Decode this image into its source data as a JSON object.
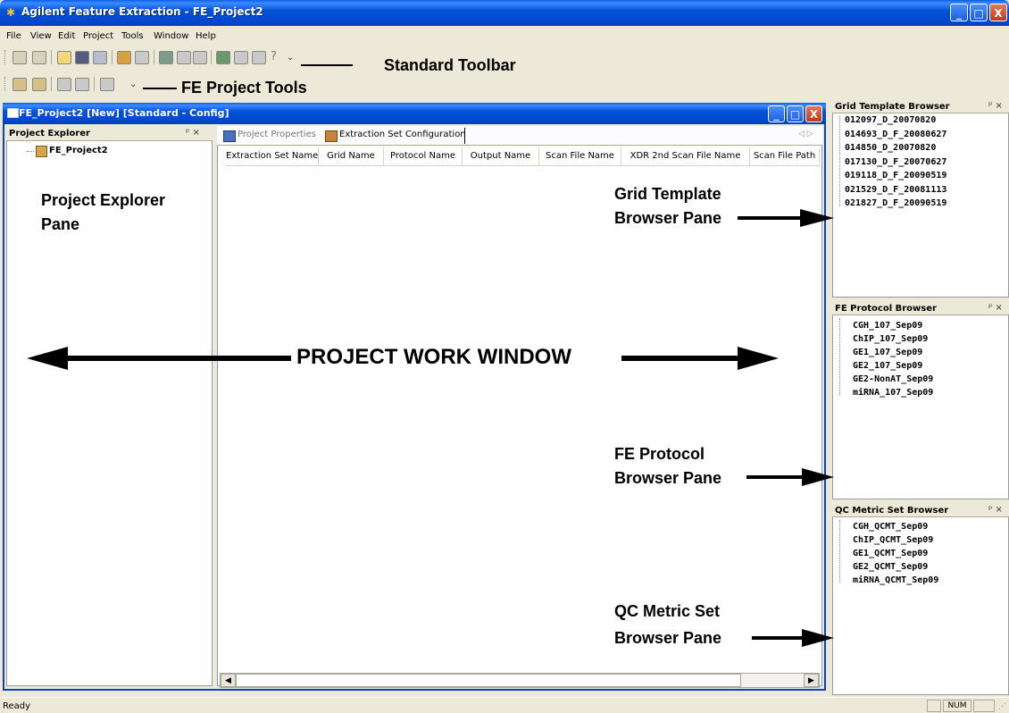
{
  "window": {
    "title": "Agilent Feature Extraction - FE_Project2",
    "minimize": "_",
    "maximize": "□",
    "close": "X"
  },
  "menu": {
    "items": [
      {
        "label": "File"
      },
      {
        "label": "View"
      },
      {
        "label": "Edit"
      },
      {
        "label": "Project"
      },
      {
        "label": "Tools"
      },
      {
        "label": "Window"
      },
      {
        "label": "Help"
      }
    ]
  },
  "callouts": {
    "standard_toolbar": "Standard Toolbar",
    "fe_project_tools": "FE Project Tools",
    "project_explorer_pane_line1": "Project Explorer",
    "project_explorer_pane_line2": "Pane",
    "project_work_window": "PROJECT WORK WINDOW",
    "grid_template_line1": "Grid Template",
    "grid_template_line2": "Browser Pane",
    "fe_protocol_line1": "FE Protocol",
    "fe_protocol_line2": "Browser Pane",
    "qc_metric_line1": "QC Metric Set",
    "qc_metric_line2": "Browser Pane"
  },
  "work_window": {
    "title": "FE_Project2 [New] [Standard - Config]"
  },
  "project_explorer": {
    "header": "Project Explorer",
    "pin": "ᵖ ×",
    "root": "FE_Project2"
  },
  "doc_tabs": [
    {
      "label": "Project Properties"
    },
    {
      "label": "Extraction Set Configuration"
    }
  ],
  "tab_nav": "◁ ▷",
  "columns": [
    "Extraction Set Name",
    "Grid Name",
    "Protocol Name",
    "Output Name",
    "Scan File Name",
    "XDR 2nd Scan File Name",
    "Scan File Path"
  ],
  "grid_template_browser": {
    "header": "Grid Template Browser",
    "pin": "ᵖ ×",
    "items": [
      "012097_D_20070820",
      "014693_D_F_20080627",
      "014850_D_20070820",
      "017130_D_F_20070627",
      "019118_D_F_20090519",
      "021529_D_F_20081113",
      "021827_D_F_20090519"
    ]
  },
  "fe_protocol_browser": {
    "header": "FE Protocol Browser",
    "pin": "ᵖ ×",
    "items": [
      "CGH_107_Sep09",
      "ChIP_107_Sep09",
      "GE1_107_Sep09",
      "GE2_107_Sep09",
      "GE2-NonAT_Sep09",
      "miRNA_107_Sep09"
    ]
  },
  "qc_metric_browser": {
    "header": "QC Metric Set Browser",
    "pin": "ᵖ ×",
    "items": [
      "CGH_QCMT_Sep09",
      "ChIP_QCMT_Sep09",
      "GE1_QCMT_Sep09",
      "GE2_QCMT_Sep09",
      "miRNA_QCMT_Sep09"
    ]
  },
  "status": {
    "text": "Ready",
    "num": "NUM"
  }
}
